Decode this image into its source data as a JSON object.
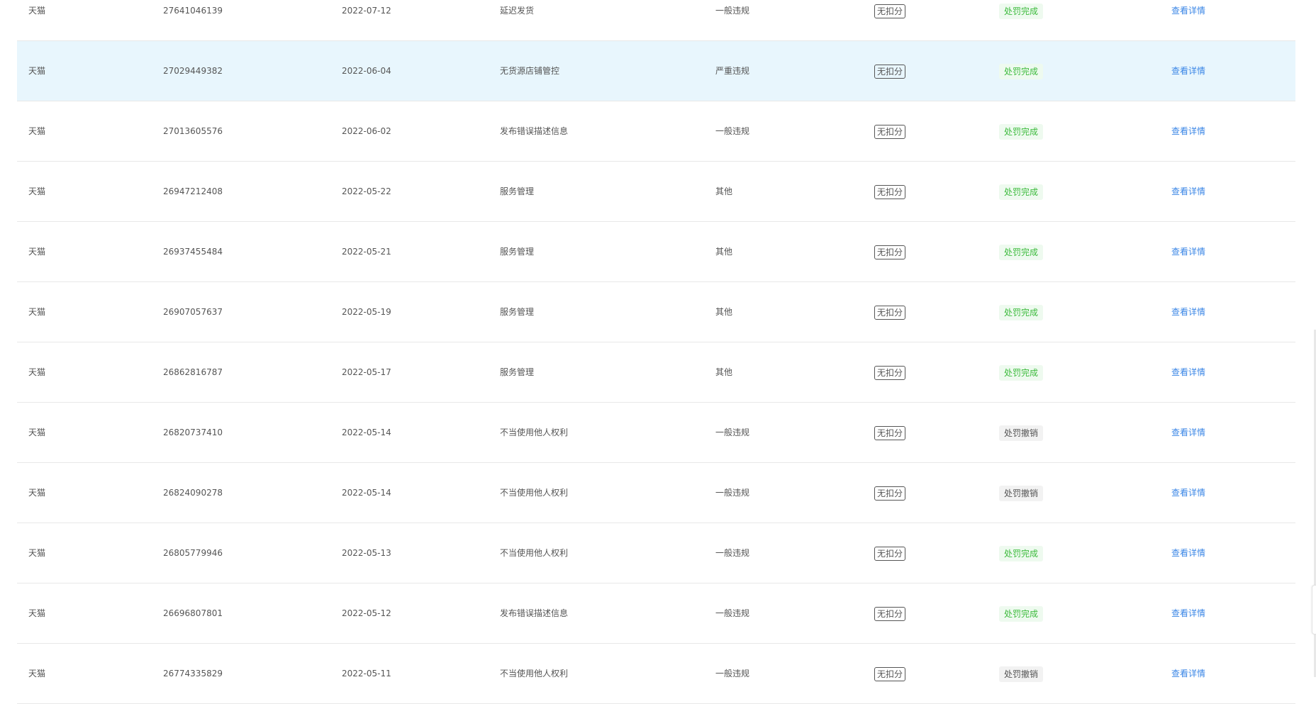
{
  "table": {
    "rows": [
      {
        "platform": "天猫",
        "id": "27641046139",
        "date": "2022-07-12",
        "reason": "延迟发货",
        "level": "一般违规",
        "score": "无扣分",
        "status": "处罚完成",
        "action": "查看详情"
      },
      {
        "platform": "天猫",
        "id": "27029449382",
        "date": "2022-06-04",
        "reason": "无货源店铺管控",
        "level": "严重违规",
        "score": "无扣分",
        "status": "处罚完成",
        "action": "查看详情"
      },
      {
        "platform": "天猫",
        "id": "27013605576",
        "date": "2022-06-02",
        "reason": "发布错误描述信息",
        "level": "一般违规",
        "score": "无扣分",
        "status": "处罚完成",
        "action": "查看详情"
      },
      {
        "platform": "天猫",
        "id": "26947212408",
        "date": "2022-05-22",
        "reason": "服务管理",
        "level": "其他",
        "score": "无扣分",
        "status": "处罚完成",
        "action": "查看详情"
      },
      {
        "platform": "天猫",
        "id": "26937455484",
        "date": "2022-05-21",
        "reason": "服务管理",
        "level": "其他",
        "score": "无扣分",
        "status": "处罚完成",
        "action": "查看详情"
      },
      {
        "platform": "天猫",
        "id": "26907057637",
        "date": "2022-05-19",
        "reason": "服务管理",
        "level": "其他",
        "score": "无扣分",
        "status": "处罚完成",
        "action": "查看详情"
      },
      {
        "platform": "天猫",
        "id": "26862816787",
        "date": "2022-05-17",
        "reason": "服务管理",
        "level": "其他",
        "score": "无扣分",
        "status": "处罚完成",
        "action": "查看详情"
      },
      {
        "platform": "天猫",
        "id": "26820737410",
        "date": "2022-05-14",
        "reason": "不当使用他人权利",
        "level": "一般违规",
        "score": "无扣分",
        "status": "处罚撤销",
        "action": "查看详情"
      },
      {
        "platform": "天猫",
        "id": "26824090278",
        "date": "2022-05-14",
        "reason": "不当使用他人权利",
        "level": "一般违规",
        "score": "无扣分",
        "status": "处罚撤销",
        "action": "查看详情"
      },
      {
        "platform": "天猫",
        "id": "26805779946",
        "date": "2022-05-13",
        "reason": "不当使用他人权利",
        "level": "一般违规",
        "score": "无扣分",
        "status": "处罚完成",
        "action": "查看详情"
      },
      {
        "platform": "天猫",
        "id": "26696807801",
        "date": "2022-05-12",
        "reason": "发布错误描述信息",
        "level": "一般违规",
        "score": "无扣分",
        "status": "处罚完成",
        "action": "查看详情"
      },
      {
        "platform": "天猫",
        "id": "26774335829",
        "date": "2022-05-11",
        "reason": "不当使用他人权利",
        "level": "一般违规",
        "score": "无扣分",
        "status": "处罚撤销",
        "action": "查看详情"
      }
    ]
  },
  "colors": {
    "status_done_bg": "#eefaef",
    "status_done_text": "#3dbb3d",
    "status_revoked_bg": "#f2f2f2",
    "status_revoked_text": "#555555",
    "link": "#3a86e6",
    "hover_row_bg": "#e8f6fd"
  }
}
